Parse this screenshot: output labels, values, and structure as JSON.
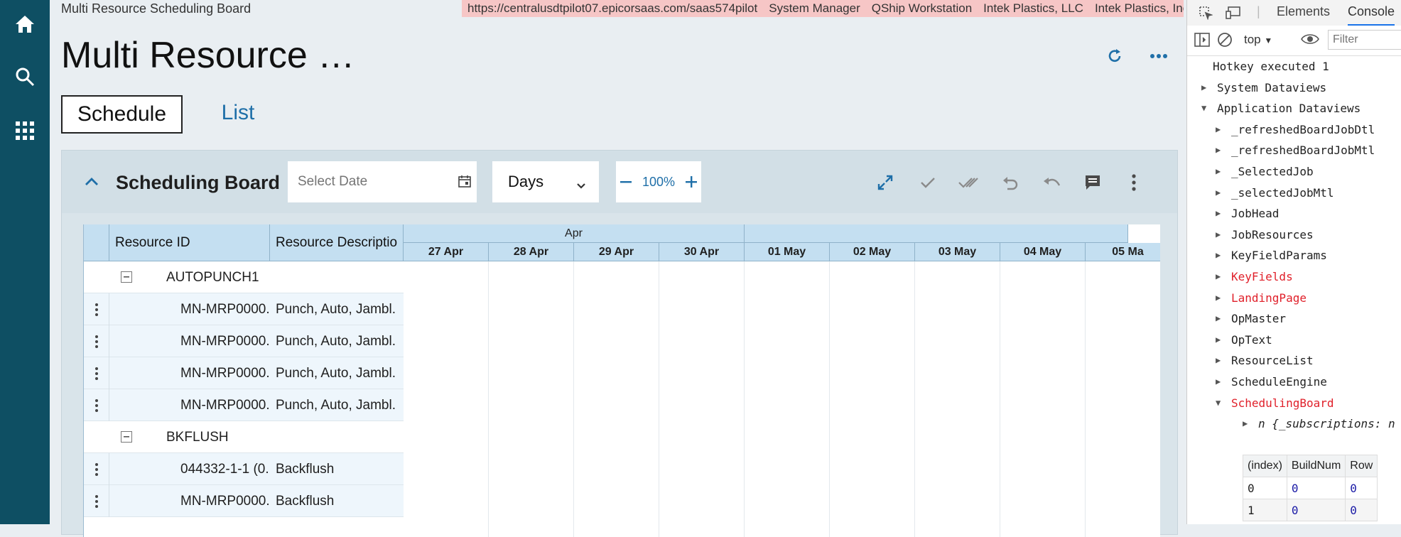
{
  "page_title_small": "Multi Resource Scheduling Board",
  "env": [
    "https://centralusdtpilot07.epicorsaas.com/saas574pilot",
    "System Manager",
    "QShip Workstation",
    "Intek Plastics, LLC",
    "Intek Plastics, Inc."
  ],
  "page_title": "Multi Resource …",
  "tabs": {
    "schedule": "Schedule",
    "list": "List"
  },
  "board": {
    "title": "Scheduling Board",
    "date_placeholder": "Select Date",
    "view": "Days",
    "zoom": "100%"
  },
  "grid": {
    "col_resource_id": "Resource ID",
    "col_resource_desc": "Resource Descriptio",
    "months": [
      "Apr",
      ""
    ],
    "days": [
      "27 Apr",
      "28 Apr",
      "29 Apr",
      "30 Apr",
      "01 May",
      "02 May",
      "03 May",
      "04 May",
      "05 Ma"
    ],
    "rows": [
      {
        "id": "AUTOPUNCH1",
        "desc": "",
        "group": true
      },
      {
        "id": "MN-MRP0000.",
        "desc": "Punch, Auto, Jambl."
      },
      {
        "id": "MN-MRP0000.",
        "desc": "Punch, Auto, Jambl."
      },
      {
        "id": "MN-MRP0000.",
        "desc": "Punch, Auto, Jambl."
      },
      {
        "id": "MN-MRP0000.",
        "desc": "Punch, Auto, Jambl."
      },
      {
        "id": "BKFLUSH",
        "desc": "",
        "group": true
      },
      {
        "id": "044332-1-1 (0.",
        "desc": "Backflush"
      },
      {
        "id": "MN-MRP0000.",
        "desc": "Backflush"
      }
    ]
  },
  "devtools": {
    "tabs": {
      "elements": "Elements",
      "console": "Console"
    },
    "context": "top",
    "filter_placeholder": "Filter",
    "lines": [
      {
        "text": "Hotkey executed 1",
        "tri": "",
        "red": false,
        "indent": 0
      },
      {
        "text": "System Dataviews",
        "tri": "right",
        "red": false,
        "indent": 1
      },
      {
        "text": "Application Dataviews",
        "tri": "down",
        "red": false,
        "indent": 1
      },
      {
        "text": "_refreshedBoardJobDtl",
        "tri": "right",
        "red": false,
        "indent": 2
      },
      {
        "text": "_refreshedBoardJobMtl",
        "tri": "right",
        "red": false,
        "indent": 2
      },
      {
        "text": "_SelectedJob",
        "tri": "right",
        "red": false,
        "indent": 2
      },
      {
        "text": "_selectedJobMtl",
        "tri": "right",
        "red": false,
        "indent": 2
      },
      {
        "text": "JobHead",
        "tri": "right",
        "red": false,
        "indent": 2
      },
      {
        "text": "JobResources",
        "tri": "right",
        "red": false,
        "indent": 2
      },
      {
        "text": "KeyFieldParams",
        "tri": "right",
        "red": false,
        "indent": 2
      },
      {
        "text": "KeyFields",
        "tri": "right",
        "red": true,
        "indent": 2
      },
      {
        "text": "LandingPage",
        "tri": "right",
        "red": true,
        "indent": 2
      },
      {
        "text": "OpMaster",
        "tri": "right",
        "red": false,
        "indent": 2
      },
      {
        "text": "OpText",
        "tri": "right",
        "red": false,
        "indent": 2
      },
      {
        "text": "ResourceList",
        "tri": "right",
        "red": false,
        "indent": 2
      },
      {
        "text": "ScheduleEngine",
        "tri": "right",
        "red": false,
        "indent": 2
      },
      {
        "text": "SchedulingBoard",
        "tri": "down",
        "red": true,
        "indent": 2
      },
      {
        "text": "n {_subscriptions: n",
        "tri": "right",
        "red": false,
        "indent": 3
      }
    ],
    "table": {
      "headers": [
        "(index)",
        "BuildNum",
        "Row"
      ],
      "rows": [
        [
          "0",
          "0",
          "0"
        ],
        [
          "1",
          "0",
          "0"
        ]
      ]
    }
  }
}
